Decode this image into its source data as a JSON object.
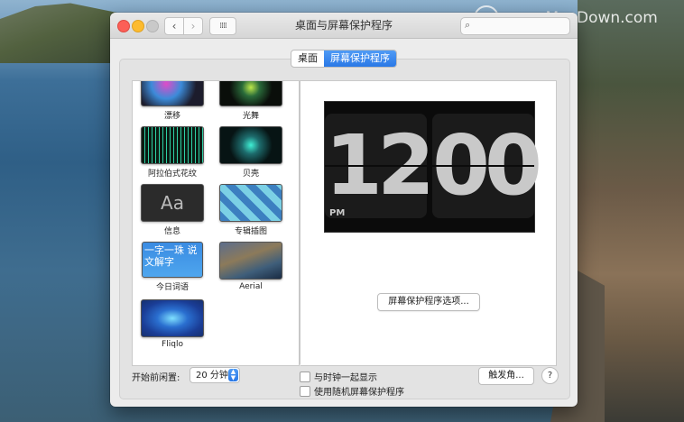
{
  "window": {
    "title": "桌面与屏幕保护程序",
    "search_placeholder": ""
  },
  "watermark": {
    "text": "www.MacDown.com"
  },
  "tabs": [
    {
      "label": "桌面",
      "active": false
    },
    {
      "label": "屏幕保护程序",
      "active": true
    }
  ],
  "screensavers": [
    {
      "label": "漂移"
    },
    {
      "label": "光舞"
    },
    {
      "label": "阿拉伯式花纹"
    },
    {
      "label": "贝壳"
    },
    {
      "label": "信息",
      "thumb_text": "Aa"
    },
    {
      "label": "专辑插图"
    },
    {
      "label": "今日词语",
      "thumb_text": "一字一珠 说文解字"
    },
    {
      "label": "Aerial"
    },
    {
      "label": "Fliqlo",
      "selected": true
    }
  ],
  "preview": {
    "hour": "12",
    "minute": "00",
    "meridiem": "PM",
    "options_label": "屏幕保护程序选项..."
  },
  "bottom": {
    "start_label": "开始前闲置:",
    "idle_value": "20 分钟",
    "show_clock_label": "与时钟一起显示",
    "random_label": "使用随机屏幕保护程序",
    "hot_corners_label": "触发角...",
    "help_label": "?"
  }
}
